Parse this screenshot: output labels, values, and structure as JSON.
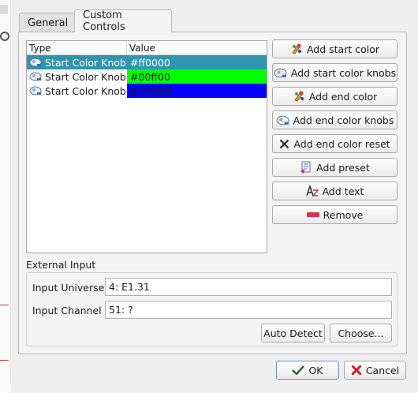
{
  "dialog": {
    "tabs": [
      {
        "label": "General"
      },
      {
        "label": "Custom Controls"
      }
    ],
    "active_tab": "Custom Controls"
  },
  "table": {
    "columns": [
      "Type",
      "Value"
    ],
    "rows": [
      {
        "type": "Start Color Knob",
        "value": "#ff0000",
        "color": "#2f95b0",
        "text_color": "#ffffff",
        "selected": true
      },
      {
        "type": "Start Color Knob",
        "value": "#00ff00",
        "color": "#00ff00",
        "text_color": "#1a1a1a",
        "selected": false
      },
      {
        "type": "Start Color Knob",
        "value": "#0000ff",
        "color": "#0000ff",
        "text_color": "#1a1a1a",
        "selected": false
      }
    ]
  },
  "actions": {
    "add_start_color": "Add start color",
    "add_start_color_knobs": "Add start color knobs",
    "add_end_color": "Add end color",
    "add_end_color_knobs": "Add end color knobs",
    "add_end_color_reset": "Add end color reset",
    "add_preset": "Add preset",
    "add_text": "Add text",
    "remove": "Remove"
  },
  "external_input": {
    "title": "External Input",
    "universe_label": "Input Universe",
    "universe_value": "4: E1.31",
    "channel_label": "Input Channel",
    "channel_value": "51: ?",
    "auto_detect": "Auto Detect",
    "choose": "Choose..."
  },
  "footer": {
    "ok": "OK",
    "cancel": "Cancel"
  },
  "colors": {
    "selection": "#3094b1",
    "panel": "#f4f4f4"
  }
}
